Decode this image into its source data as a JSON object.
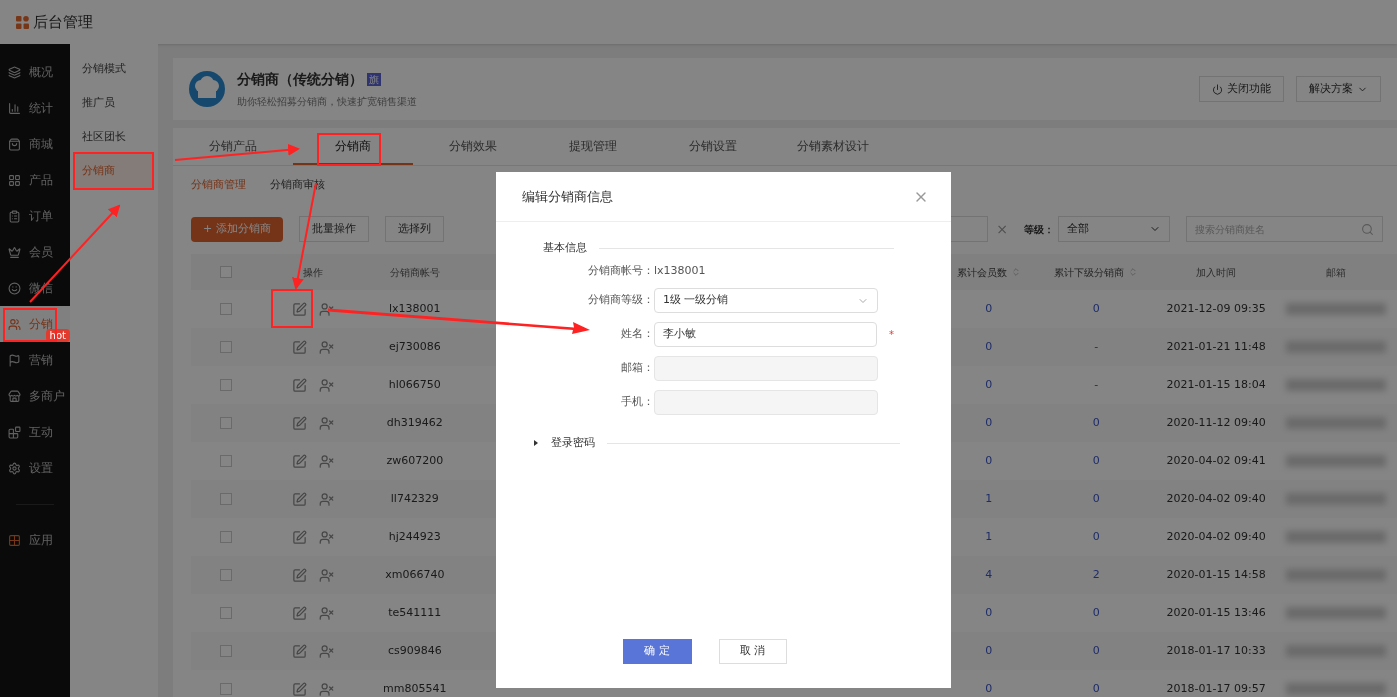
{
  "app": {
    "title": "后台管理"
  },
  "sidebar": {
    "items": [
      {
        "label": "概况",
        "selected": false
      },
      {
        "label": "统计",
        "selected": false
      },
      {
        "label": "商城",
        "selected": false
      },
      {
        "label": "产品",
        "selected": false
      },
      {
        "label": "订单",
        "selected": false
      },
      {
        "label": "会员",
        "selected": false
      },
      {
        "label": "微信",
        "selected": false
      },
      {
        "label": "分销",
        "selected": true,
        "badge": "hot"
      },
      {
        "label": "营销",
        "selected": false
      },
      {
        "label": "多商户",
        "selected": false
      },
      {
        "label": "互动",
        "selected": false
      },
      {
        "label": "设置",
        "selected": false
      },
      {
        "label": "应用",
        "selected": false
      }
    ]
  },
  "subnav": {
    "items": [
      {
        "label": "分销模式",
        "selected": false
      },
      {
        "label": "推广员",
        "selected": false
      },
      {
        "label": "社区团长",
        "selected": false
      },
      {
        "label": "分销商",
        "selected": true
      }
    ]
  },
  "header_card": {
    "title": "分销商（传统分销）",
    "tag": "旗",
    "subtitle": "助你轻松招募分销商，快速扩宽销售渠道",
    "buttons": [
      "关闭功能",
      "解决方案"
    ]
  },
  "tabs": [
    {
      "label": "分销产品",
      "selected": false
    },
    {
      "label": "分销商",
      "selected": true
    },
    {
      "label": "分销效果",
      "selected": false
    },
    {
      "label": "提现管理",
      "selected": false
    },
    {
      "label": "分销设置",
      "selected": false
    },
    {
      "label": "分销素材设计",
      "selected": false
    }
  ],
  "subtabs": [
    {
      "label": "分销商管理",
      "selected": true
    },
    {
      "label": "分销商审核",
      "selected": false
    }
  ],
  "toolbar": {
    "buttons": [
      {
        "label": "添加分销商",
        "kind": "primary",
        "icon_text": "+"
      },
      {
        "label": "批量操作",
        "kind": "default"
      },
      {
        "label": "选择列",
        "kind": "default"
      }
    ]
  },
  "filters": {
    "clear_text": "×",
    "level_label": "等级：",
    "level_value": "全部",
    "search_placeholder": "搜索分销商姓名"
  },
  "table": {
    "all_checked": false,
    "columns": [
      {
        "label": "操作"
      },
      {
        "label": "分销商帐号"
      },
      {
        "label": "累计会员数",
        "sortable": true
      },
      {
        "label": "累计下级分销商",
        "sortable": true
      },
      {
        "label": "加入时间"
      },
      {
        "label": "邮箱"
      }
    ],
    "rows": [
      {
        "checked": false,
        "account": "lx138001",
        "members": "0",
        "subordinates": "0",
        "joined": "2021-12-09 09:35"
      },
      {
        "checked": false,
        "account": "ej730086",
        "members": "0",
        "subordinates": "-",
        "joined": "2021-01-21 11:48"
      },
      {
        "checked": false,
        "account": "hl066750",
        "members": "0",
        "subordinates": "-",
        "joined": "2021-01-15 18:04"
      },
      {
        "checked": false,
        "account": "dh319462",
        "members": "0",
        "subordinates": "0",
        "joined": "2020-11-12 09:40"
      },
      {
        "checked": false,
        "account": "zw607200",
        "members": "0",
        "subordinates": "0",
        "joined": "2020-04-02 09:41"
      },
      {
        "checked": false,
        "account": "ll742329",
        "members": "1",
        "subordinates": "0",
        "joined": "2020-04-02 09:40"
      },
      {
        "checked": false,
        "account": "hj244923",
        "members": "1",
        "subordinates": "0",
        "joined": "2020-04-02 09:40"
      },
      {
        "checked": false,
        "account": "xm066740",
        "members": "4",
        "subordinates": "2",
        "joined": "2020-01-15 14:58"
      },
      {
        "checked": false,
        "account": "te541111",
        "members": "0",
        "subordinates": "0",
        "joined": "2020-01-15 13:46"
      },
      {
        "checked": false,
        "account": "cs909846",
        "members": "0",
        "subordinates": "0",
        "joined": "2018-01-17 10:33"
      },
      {
        "checked": false,
        "account": "mm805541",
        "members": "0",
        "subordinates": "0",
        "joined": "2018-01-17 09:57"
      }
    ]
  },
  "modal": {
    "title": "编辑分销商信息",
    "section": "基本信息",
    "account_label": "分销商帐号：",
    "account_value": "lx138001",
    "level_label": "分销商等级：",
    "level_value": "1级 一级分销",
    "name_label": "姓名：",
    "name_value": "李小敏",
    "required_mark": "*",
    "email_label": "邮箱：",
    "phone_label": "手机：",
    "password_section": "登录密码",
    "password_expanded": false,
    "ok": "确 定",
    "cancel": "取 消"
  }
}
